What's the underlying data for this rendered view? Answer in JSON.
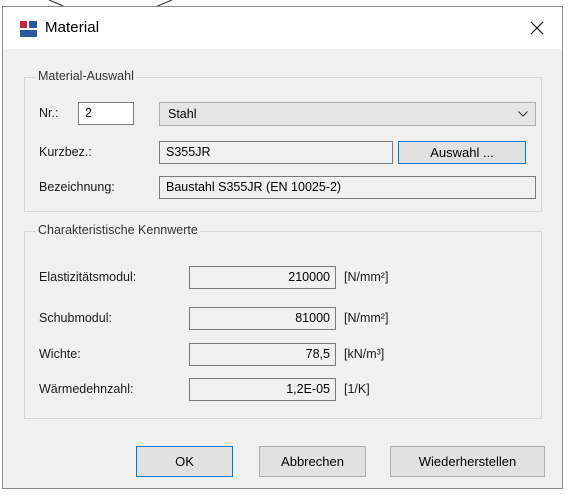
{
  "window": {
    "title": "Material",
    "close_glyph": "✕",
    "icon": "app-material-icon",
    "accent": "#0078d7",
    "icon_colors": [
      "#c8283b",
      "#2c5aa0"
    ]
  },
  "material_selection": {
    "group_label": "Material-Auswahl",
    "nr_label": "Nr.:",
    "nr_value": "2",
    "category_selected": "Stahl",
    "short_label": "Kurzbez.:",
    "short_value": "S355JR",
    "select_button": "Auswahl ...",
    "name_label": "Bezeichnung:",
    "name_value": "Baustahl S355JR (EN 10025-2)"
  },
  "characteristics": {
    "group_label": "Charakteristische Kennwerte",
    "rows": [
      {
        "label": "Elastizitätsmodul:",
        "value": "210000",
        "unit": "[N/mm²]"
      },
      {
        "label": "Schubmodul:",
        "value": "81000",
        "unit": "[N/mm²]"
      },
      {
        "label": "Wichte:",
        "value": "78,5",
        "unit": "[kN/m³]"
      },
      {
        "label": "Wärmedehnzahl:",
        "value": "1,2E-05",
        "unit": "[1/K]"
      }
    ]
  },
  "buttons": {
    "ok": "OK",
    "cancel": "Abbrechen",
    "restore": "Wiederherstellen"
  }
}
